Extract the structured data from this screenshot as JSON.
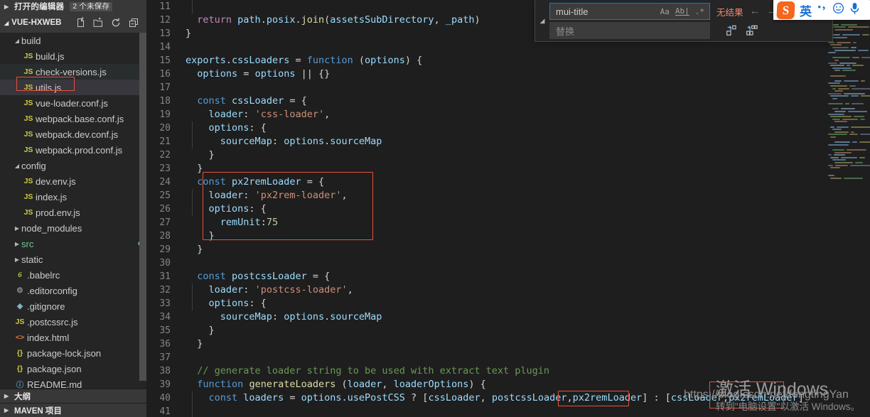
{
  "sidebar": {
    "open_editors": {
      "label": "打开的编辑器",
      "badge": "2 个未保存"
    },
    "project": {
      "label": "VUE-HXWEB"
    },
    "toolbar": [
      {
        "name": "new-file-icon",
        "title": "新建文件"
      },
      {
        "name": "new-folder-icon",
        "title": "新建文件夹"
      },
      {
        "name": "refresh-icon",
        "title": "刷新"
      },
      {
        "name": "collapse-all-icon",
        "title": "折叠文件夹"
      }
    ],
    "tree": [
      {
        "label": "build",
        "kind": "folder",
        "indent": 1,
        "expanded": true
      },
      {
        "label": "build.js",
        "kind": "js",
        "indent": 2
      },
      {
        "label": "check-versions.js",
        "kind": "js",
        "indent": 2,
        "state": "hover"
      },
      {
        "label": "utils.js",
        "kind": "js",
        "indent": 2,
        "state": "selected",
        "highlighted": true
      },
      {
        "label": "vue-loader.conf.js",
        "kind": "js",
        "indent": 2
      },
      {
        "label": "webpack.base.conf.js",
        "kind": "js",
        "indent": 2
      },
      {
        "label": "webpack.dev.conf.js",
        "kind": "js",
        "indent": 2
      },
      {
        "label": "webpack.prod.conf.js",
        "kind": "js",
        "indent": 2
      },
      {
        "label": "config",
        "kind": "folder",
        "indent": 1,
        "expanded": true
      },
      {
        "label": "dev.env.js",
        "kind": "js",
        "indent": 2
      },
      {
        "label": "index.js",
        "kind": "js",
        "indent": 2
      },
      {
        "label": "prod.env.js",
        "kind": "js",
        "indent": 2
      },
      {
        "label": "node_modules",
        "kind": "folder",
        "indent": 1,
        "expanded": false
      },
      {
        "label": "src",
        "kind": "folder",
        "indent": 1,
        "expanded": false,
        "color": "green",
        "dot": "●"
      },
      {
        "label": "static",
        "kind": "folder",
        "indent": 1,
        "expanded": false
      },
      {
        "label": ".babelrc",
        "kind": "babel",
        "indent": 1
      },
      {
        "label": ".editorconfig",
        "kind": "gear",
        "indent": 1
      },
      {
        "label": ".gitignore",
        "kind": "git",
        "indent": 1
      },
      {
        "label": ".postcssrc.js",
        "kind": "js",
        "indent": 1
      },
      {
        "label": "index.html",
        "kind": "html",
        "indent": 1
      },
      {
        "label": "package-lock.json",
        "kind": "json",
        "indent": 1
      },
      {
        "label": "package.json",
        "kind": "json",
        "indent": 1
      },
      {
        "label": "README.md",
        "kind": "md",
        "indent": 1
      }
    ],
    "bottom_panels": [
      {
        "label": "大纲"
      },
      {
        "label": "MAVEN 项目"
      }
    ]
  },
  "find_widget": {
    "search_value": "mui-title",
    "replace_placeholder": "替换",
    "result_text": "无结果",
    "options": [
      {
        "name": "match-case-icon",
        "glyph": "Aa"
      },
      {
        "name": "whole-word-icon",
        "glyph": "Ab|"
      },
      {
        "name": "regex-icon",
        "glyph": ".*"
      }
    ],
    "nav": [
      {
        "name": "find-previous-icon",
        "glyph": "←"
      },
      {
        "name": "find-next-icon",
        "glyph": "→"
      }
    ],
    "replace_actions": [
      {
        "name": "replace-icon"
      },
      {
        "name": "replace-all-icon"
      }
    ]
  },
  "ime_bar": {
    "logo": "S",
    "mode": "英",
    "items": [
      {
        "name": "punctuation-icon",
        "glyph": "•,"
      },
      {
        "name": "emoji-icon",
        "glyph": "☺"
      },
      {
        "name": "microphone-icon",
        "glyph": "🎤"
      }
    ]
  },
  "editor": {
    "first_line_number": 11,
    "lines": [
      {
        "n": 11,
        "tokens": []
      },
      {
        "n": 12,
        "tokens": [
          {
            "t": "  ",
            "c": "t-pun"
          },
          {
            "t": "return",
            "c": "t-kw"
          },
          {
            "t": " path",
            "c": "t-var"
          },
          {
            "t": ".",
            "c": "t-pun"
          },
          {
            "t": "posix",
            "c": "t-var"
          },
          {
            "t": ".",
            "c": "t-pun"
          },
          {
            "t": "join",
            "c": "t-fn"
          },
          {
            "t": "(",
            "c": "t-pun"
          },
          {
            "t": "assetsSubDirectory",
            "c": "t-var"
          },
          {
            "t": ", ",
            "c": "t-pun"
          },
          {
            "t": "_path",
            "c": "t-var"
          },
          {
            "t": ")",
            "c": "t-pun"
          }
        ]
      },
      {
        "n": 13,
        "tokens": [
          {
            "t": "}",
            "c": "t-pun"
          }
        ]
      },
      {
        "n": 14,
        "tokens": []
      },
      {
        "n": 15,
        "tokens": [
          {
            "t": "exports",
            "c": "t-var"
          },
          {
            "t": ".",
            "c": "t-pun"
          },
          {
            "t": "cssLoaders",
            "c": "t-var"
          },
          {
            "t": " = ",
            "c": "t-pun"
          },
          {
            "t": "function",
            "c": "t-dec"
          },
          {
            "t": " (",
            "c": "t-pun"
          },
          {
            "t": "options",
            "c": "t-var"
          },
          {
            "t": ") {",
            "c": "t-pun"
          }
        ]
      },
      {
        "n": 16,
        "tokens": [
          {
            "t": "  ",
            "c": "t-pun"
          },
          {
            "t": "options",
            "c": "t-var"
          },
          {
            "t": " = ",
            "c": "t-pun"
          },
          {
            "t": "options",
            "c": "t-var"
          },
          {
            "t": " || {}",
            "c": "t-pun"
          }
        ]
      },
      {
        "n": 17,
        "tokens": []
      },
      {
        "n": 18,
        "tokens": [
          {
            "t": "  ",
            "c": "t-pun"
          },
          {
            "t": "const",
            "c": "t-dec"
          },
          {
            "t": " ",
            "c": "t-pun"
          },
          {
            "t": "cssLoader",
            "c": "t-var"
          },
          {
            "t": " = {",
            "c": "t-pun"
          }
        ]
      },
      {
        "n": 19,
        "tokens": [
          {
            "t": "    ",
            "c": "t-pun"
          },
          {
            "t": "loader",
            "c": "t-prop"
          },
          {
            "t": ": ",
            "c": "t-pun"
          },
          {
            "t": "'css-loader'",
            "c": "t-str"
          },
          {
            "t": ",",
            "c": "t-pun"
          }
        ]
      },
      {
        "n": 20,
        "tokens": [
          {
            "t": "    ",
            "c": "t-pun"
          },
          {
            "t": "options",
            "c": "t-prop"
          },
          {
            "t": ": {",
            "c": "t-pun"
          }
        ]
      },
      {
        "n": 21,
        "tokens": [
          {
            "t": "      ",
            "c": "t-pun"
          },
          {
            "t": "sourceMap",
            "c": "t-prop"
          },
          {
            "t": ": ",
            "c": "t-pun"
          },
          {
            "t": "options",
            "c": "t-var"
          },
          {
            "t": ".",
            "c": "t-pun"
          },
          {
            "t": "sourceMap",
            "c": "t-var"
          }
        ]
      },
      {
        "n": 22,
        "tokens": [
          {
            "t": "    }",
            "c": "t-pun"
          }
        ]
      },
      {
        "n": 23,
        "tokens": [
          {
            "t": "  }",
            "c": "t-pun"
          }
        ]
      },
      {
        "n": 24,
        "tokens": [
          {
            "t": "  ",
            "c": "t-pun"
          },
          {
            "t": "const",
            "c": "t-dec"
          },
          {
            "t": " ",
            "c": "t-pun"
          },
          {
            "t": "px2remLoader",
            "c": "t-var"
          },
          {
            "t": " = {",
            "c": "t-pun"
          }
        ]
      },
      {
        "n": 25,
        "tokens": [
          {
            "t": "    ",
            "c": "t-pun"
          },
          {
            "t": "loader",
            "c": "t-prop"
          },
          {
            "t": ": ",
            "c": "t-pun"
          },
          {
            "t": "'px2rem-loader'",
            "c": "t-str"
          },
          {
            "t": ",",
            "c": "t-pun"
          }
        ]
      },
      {
        "n": 26,
        "tokens": [
          {
            "t": "    ",
            "c": "t-pun"
          },
          {
            "t": "options",
            "c": "t-prop"
          },
          {
            "t": ": {",
            "c": "t-pun"
          }
        ]
      },
      {
        "n": 27,
        "tokens": [
          {
            "t": "      ",
            "c": "t-pun"
          },
          {
            "t": "remUnit",
            "c": "t-prop"
          },
          {
            "t": ":",
            "c": "t-pun"
          },
          {
            "t": "75",
            "c": "t-num"
          }
        ]
      },
      {
        "n": 28,
        "tokens": [
          {
            "t": "    }",
            "c": "t-pun"
          }
        ]
      },
      {
        "n": 29,
        "tokens": [
          {
            "t": "  }",
            "c": "t-pun"
          }
        ]
      },
      {
        "n": 30,
        "tokens": []
      },
      {
        "n": 31,
        "tokens": [
          {
            "t": "  ",
            "c": "t-pun"
          },
          {
            "t": "const",
            "c": "t-dec"
          },
          {
            "t": " ",
            "c": "t-pun"
          },
          {
            "t": "postcssLoader",
            "c": "t-var"
          },
          {
            "t": " = {",
            "c": "t-pun"
          }
        ]
      },
      {
        "n": 32,
        "tokens": [
          {
            "t": "    ",
            "c": "t-pun"
          },
          {
            "t": "loader",
            "c": "t-prop"
          },
          {
            "t": ": ",
            "c": "t-pun"
          },
          {
            "t": "'postcss-loader'",
            "c": "t-str"
          },
          {
            "t": ",",
            "c": "t-pun"
          }
        ]
      },
      {
        "n": 33,
        "tokens": [
          {
            "t": "    ",
            "c": "t-pun"
          },
          {
            "t": "options",
            "c": "t-prop"
          },
          {
            "t": ": {",
            "c": "t-pun"
          }
        ]
      },
      {
        "n": 34,
        "tokens": [
          {
            "t": "      ",
            "c": "t-pun"
          },
          {
            "t": "sourceMap",
            "c": "t-prop"
          },
          {
            "t": ": ",
            "c": "t-pun"
          },
          {
            "t": "options",
            "c": "t-var"
          },
          {
            "t": ".",
            "c": "t-pun"
          },
          {
            "t": "sourceMap",
            "c": "t-var"
          }
        ]
      },
      {
        "n": 35,
        "tokens": [
          {
            "t": "    }",
            "c": "t-pun"
          }
        ]
      },
      {
        "n": 36,
        "tokens": [
          {
            "t": "  }",
            "c": "t-pun"
          }
        ]
      },
      {
        "n": 37,
        "tokens": []
      },
      {
        "n": 38,
        "tokens": [
          {
            "t": "  // generate loader string to be used with extract text plugin",
            "c": "t-com"
          }
        ]
      },
      {
        "n": 39,
        "tokens": [
          {
            "t": "  ",
            "c": "t-pun"
          },
          {
            "t": "function",
            "c": "t-dec"
          },
          {
            "t": " ",
            "c": "t-pun"
          },
          {
            "t": "generateLoaders",
            "c": "t-fn"
          },
          {
            "t": " (",
            "c": "t-pun"
          },
          {
            "t": "loader",
            "c": "t-var"
          },
          {
            "t": ", ",
            "c": "t-pun"
          },
          {
            "t": "loaderOptions",
            "c": "t-var"
          },
          {
            "t": ") {",
            "c": "t-pun"
          }
        ]
      },
      {
        "n": 40,
        "tokens": [
          {
            "t": "    ",
            "c": "t-pun"
          },
          {
            "t": "const",
            "c": "t-dec"
          },
          {
            "t": " ",
            "c": "t-pun"
          },
          {
            "t": "loaders",
            "c": "t-var"
          },
          {
            "t": " = ",
            "c": "t-pun"
          },
          {
            "t": "options",
            "c": "t-var"
          },
          {
            "t": ".",
            "c": "t-pun"
          },
          {
            "t": "usePostCSS",
            "c": "t-var"
          },
          {
            "t": " ? [",
            "c": "t-pun"
          },
          {
            "t": "cssLoader",
            "c": "t-var"
          },
          {
            "t": ", ",
            "c": "t-pun"
          },
          {
            "t": "postcssLoader",
            "c": "t-var"
          },
          {
            "t": ",",
            "c": "t-pun"
          },
          {
            "t": "px2remLoader",
            "c": "t-var"
          },
          {
            "t": "] : [",
            "c": "t-pun"
          },
          {
            "t": "cssLoader",
            "c": "t-var"
          },
          {
            "t": ",",
            "c": "t-pun"
          },
          {
            "t": "px2remLoader",
            "c": "t-var"
          },
          {
            "t": "]",
            "c": "t-pun"
          }
        ]
      },
      {
        "n": 41,
        "tokens": []
      }
    ],
    "annotations": [
      {
        "name": "highlight-box-px2rem-loader-def"
      },
      {
        "name": "highlight-box-px2rem-loader-usage-1"
      },
      {
        "name": "highlight-box-px2rem-loader-usage-2"
      }
    ]
  },
  "watermark": {
    "line1": "激活 Windows",
    "line2": "转到\"电脑设置\"以激活 Windows。",
    "csdn": "https://blog.csdn.net/fengtingYan"
  },
  "colors": {
    "accent_red": "#e8503a",
    "editor_bg": "#1e1e1e",
    "sidebar_bg": "#252526",
    "selected_row": "#37373d",
    "ime_blue": "#1a6fd4",
    "sogou_orange": "#f5661e"
  }
}
